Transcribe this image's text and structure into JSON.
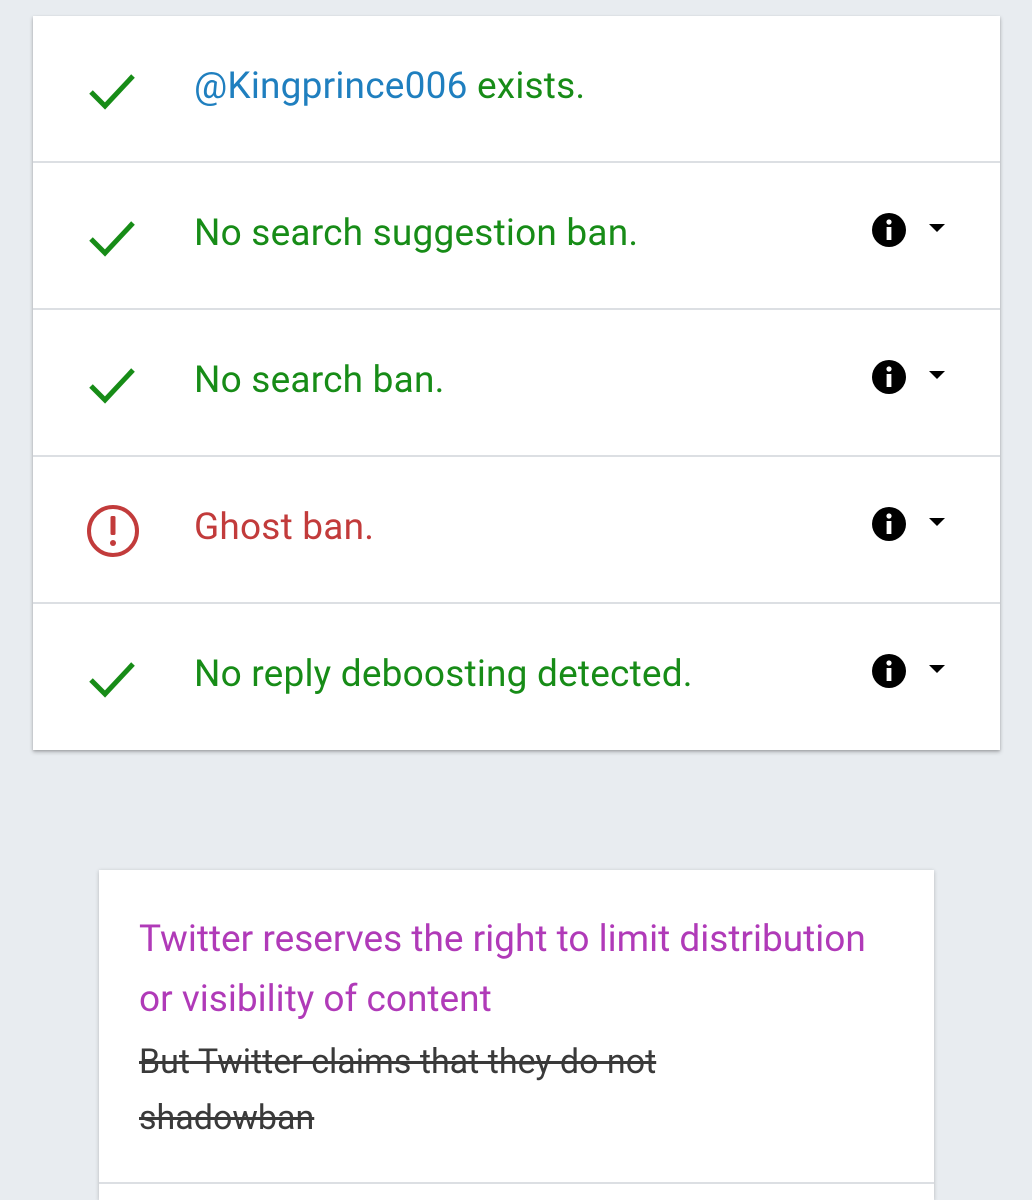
{
  "results": [
    {
      "status": "ok",
      "status_icon": "check-icon",
      "handle": "@Kingprince006",
      "text": " exists.",
      "has_info": false
    },
    {
      "status": "ok",
      "status_icon": "check-icon",
      "text": "No search suggestion ban.",
      "has_info": true
    },
    {
      "status": "ok",
      "status_icon": "check-icon",
      "text": "No search ban.",
      "has_info": true
    },
    {
      "status": "error",
      "status_icon": "alert-circle-icon",
      "text": "Ghost ban.",
      "has_info": true
    },
    {
      "status": "ok",
      "status_icon": "check-icon",
      "text": "No reply deboosting detected.",
      "has_info": true
    }
  ],
  "notice": {
    "headline": "Twitter reserves the right to limit distribution or visibility of content",
    "struck_text": "But Twitter claims that they do not shadowban"
  },
  "colors": {
    "ok": "#178c17",
    "error": "#c23b3b",
    "handle": "#1f7fbf",
    "headline": "#b03ab8",
    "background": "#e8ecf0"
  }
}
